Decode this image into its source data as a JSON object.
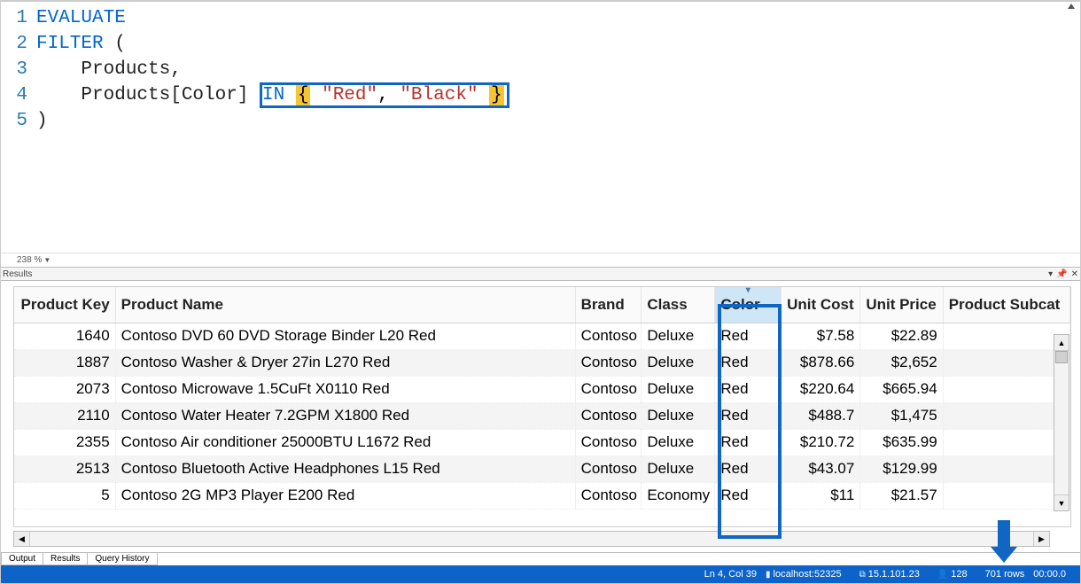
{
  "editor": {
    "lines": [
      {
        "n": "1",
        "tokens": [
          {
            "t": "EVALUATE",
            "cls": "kw"
          }
        ]
      },
      {
        "n": "2",
        "tokens": [
          {
            "t": "FILTER",
            "cls": "kw"
          },
          {
            "t": " (",
            "cls": "br"
          }
        ]
      },
      {
        "n": "3",
        "tokens": [
          {
            "t": "    Products,",
            "cls": "tbl"
          }
        ]
      },
      {
        "n": "4",
        "tokens": [
          {
            "t": "    Products[Color] ",
            "cls": "tbl"
          },
          {
            "boxstart": true
          },
          {
            "t": "IN",
            "cls": "kw"
          },
          {
            "t": " ",
            "cls": ""
          },
          {
            "t": "{",
            "cls": "hl-brace"
          },
          {
            "t": " ",
            "cls": ""
          },
          {
            "t": "\"Red\"",
            "cls": "str"
          },
          {
            "t": ", ",
            "cls": ""
          },
          {
            "t": "\"Black\"",
            "cls": "str"
          },
          {
            "t": " ",
            "cls": ""
          },
          {
            "t": "}",
            "cls": "hl-brace"
          },
          {
            "boxend": true
          }
        ]
      },
      {
        "n": "5",
        "tokens": [
          {
            "t": ")",
            "cls": "br"
          }
        ]
      }
    ],
    "zoom": "238 %"
  },
  "results": {
    "panel_label": "Results",
    "columns": [
      "Product Key",
      "Product Name",
      "Brand",
      "Class",
      "Color",
      "Unit Cost",
      "Unit Price",
      "Product Subcat"
    ],
    "rows": [
      {
        "key": "1640",
        "name": "Contoso DVD 60 DVD Storage Binder L20 Red",
        "brand": "Contoso",
        "class": "Deluxe",
        "color": "Red",
        "cost": "$7.58",
        "price": "$22.89"
      },
      {
        "key": "1887",
        "name": "Contoso Washer & Dryer 27in L270 Red",
        "brand": "Contoso",
        "class": "Deluxe",
        "color": "Red",
        "cost": "$878.66",
        "price": "$2,652"
      },
      {
        "key": "2073",
        "name": "Contoso Microwave 1.5CuFt X0110 Red",
        "brand": "Contoso",
        "class": "Deluxe",
        "color": "Red",
        "cost": "$220.64",
        "price": "$665.94"
      },
      {
        "key": "2110",
        "name": "Contoso Water Heater 7.2GPM X1800 Red",
        "brand": "Contoso",
        "class": "Deluxe",
        "color": "Red",
        "cost": "$488.7",
        "price": "$1,475"
      },
      {
        "key": "2355",
        "name": "Contoso Air conditioner 25000BTU L1672 Red",
        "brand": "Contoso",
        "class": "Deluxe",
        "color": "Red",
        "cost": "$210.72",
        "price": "$635.99"
      },
      {
        "key": "2513",
        "name": "Contoso Bluetooth Active Headphones L15 Red",
        "brand": "Contoso",
        "class": "Deluxe",
        "color": "Red",
        "cost": "$43.07",
        "price": "$129.99"
      },
      {
        "key": "5",
        "name": "Contoso 2G MP3 Player E200 Red",
        "brand": "Contoso",
        "class": "Economy",
        "color": "Red",
        "cost": "$11",
        "price": "$21.57"
      }
    ]
  },
  "tabs": {
    "items": [
      "Output",
      "Results",
      "Query History"
    ],
    "active": 1
  },
  "status": {
    "position": "Ln 4, Col 39",
    "server": "localhost:52325",
    "version": "15.1.101.23",
    "user_count": "128",
    "rowcount": "701 rows",
    "elapsed": "00:00.0"
  }
}
